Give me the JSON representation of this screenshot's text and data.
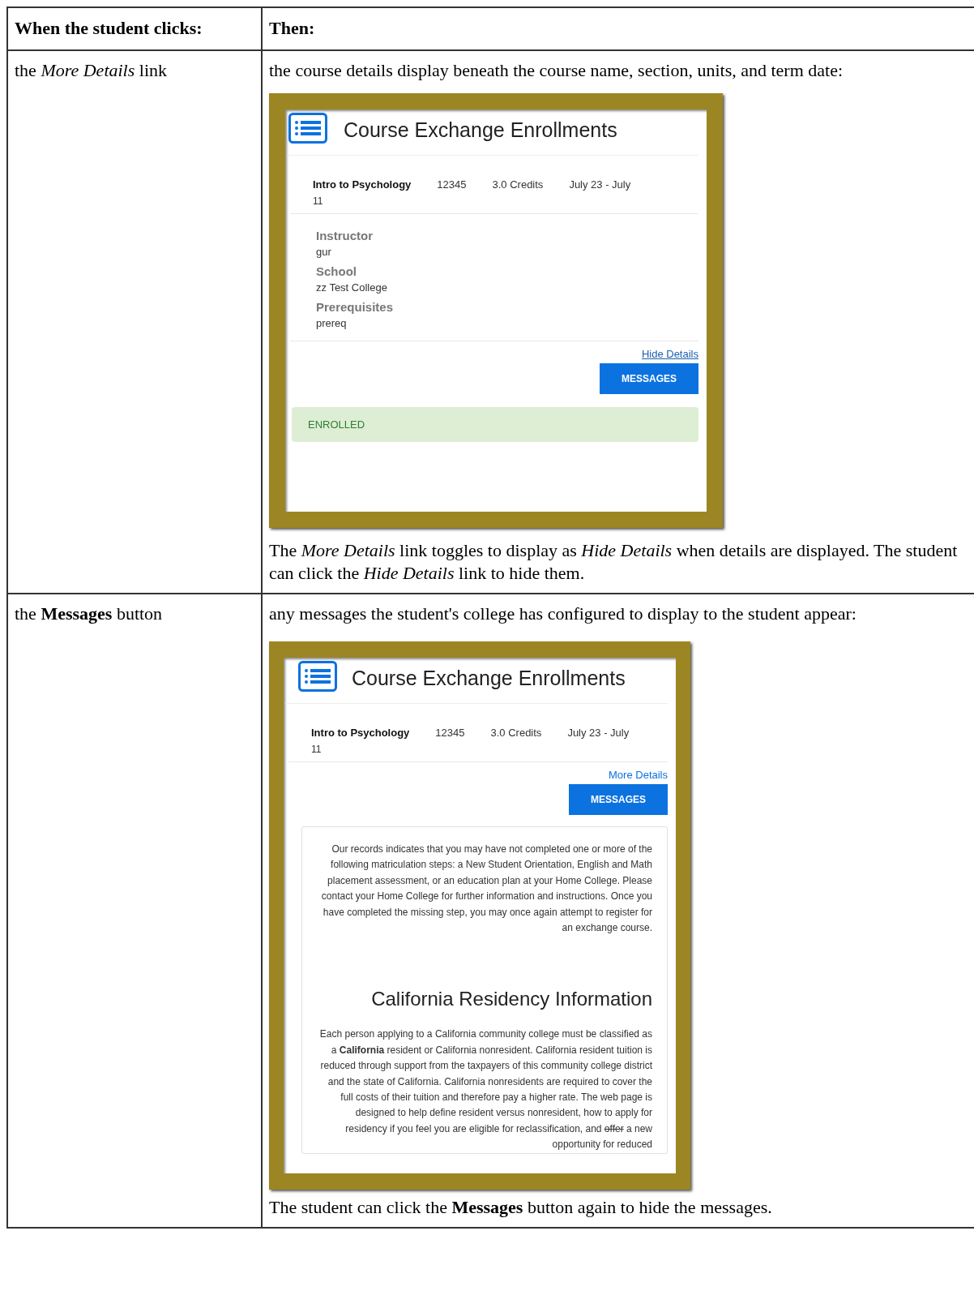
{
  "table": {
    "columns": [
      "When the student clicks:",
      "Then:"
    ],
    "rows": [
      {
        "trigger": "the *More Details* link",
        "intro": "the course details display beneath the course name, section, units, and term date:",
        "screenshot": {
          "title": "Course Exchange Enrollments",
          "course": {
            "name": "Intro to Psychology",
            "section": "12345",
            "credits": "3.0 Credits",
            "dates": [
              "July 23 - July",
              "11"
            ]
          },
          "details": [
            {
              "label": "Instructor",
              "value": "gur"
            },
            {
              "label": "School",
              "value": "zz Test College"
            },
            {
              "label": "Prerequisites",
              "value": "prereq"
            }
          ],
          "link": {
            "label": "Hide Details",
            "underlined": true
          },
          "button": "MESSAGES",
          "status": "ENROLLED"
        },
        "after": "The *More Details* link toggles to display as *Hide Details* when details are displayed. The student can click the *Hide Details* link to hide them."
      },
      {
        "trigger": "the **Messages** button",
        "intro": "any messages the student's college has configured to display to the student appear:",
        "screenshot": {
          "title": "Course Exchange Enrollments",
          "course": {
            "name": "Intro to Psychology",
            "section": "12345",
            "credits": "3.0 Credits",
            "dates": [
              "July 23 - July",
              "11"
            ]
          },
          "link": {
            "label": "More Details",
            "underlined": false
          },
          "button": "MESSAGES",
          "messages": {
            "notice": "Our records indicates that you may have not completed one or more of the following matriculation steps: a New Student Orientation, English and Math placement assessment, or an education plan at your Home College.  Please contact your Home College for further information and instructions. Once you have completed the missing step, you may once again attempt to register for an exchange course.",
            "heading": "California Residency Information",
            "body": [
              {
                "kind": "plain",
                "text": "Each person applying to a California community college must be classified as a **California** resident or California nonresident. California resident tuition is reduced through support from the taxpayers of this community college district and the state of California. California nonresidents are required to cover the full costs of their tuition and therefore pay a higher rate. The web page is designed to help define resident versus nonresident, how to apply for residency if you feel you are eligible for reclassification, and "
              },
              {
                "kind": "strike",
                "text": "offer"
              },
              {
                "kind": "plain",
                "text": " a new opportunity for reduced"
              }
            ]
          }
        },
        "after": "The student can click the **Messages** button again to hide the messages."
      }
    ]
  }
}
